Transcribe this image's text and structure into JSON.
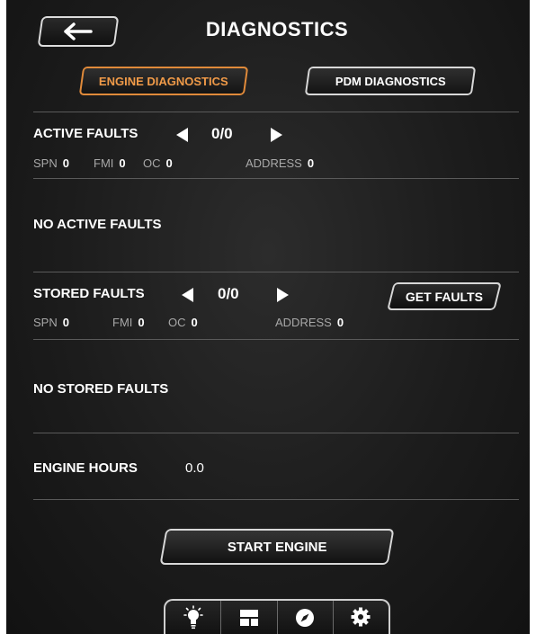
{
  "header": {
    "title": "DIAGNOSTICS",
    "back_icon": "arrow-left-icon"
  },
  "tabs": [
    {
      "label": "ENGINE DIAGNOSTICS",
      "active": true
    },
    {
      "label": "PDM DIAGNOSTICS",
      "active": false
    }
  ],
  "active_faults": {
    "label": "ACTIVE FAULTS",
    "counter": "0/0",
    "spn_label": "SPN",
    "spn": "0",
    "fmi_label": "FMI",
    "fmi": "0",
    "oc_label": "OC",
    "oc": "0",
    "address_label": "ADDRESS",
    "address": "0",
    "message": "NO ACTIVE FAULTS"
  },
  "stored_faults": {
    "label": "STORED FAULTS",
    "counter": "0/0",
    "get_button": "GET FAULTS",
    "spn_label": "SPN",
    "spn": "0",
    "fmi_label": "FMI",
    "fmi": "0",
    "oc_label": "OC",
    "oc": "0",
    "address_label": "ADDRESS",
    "address": "0",
    "message": "NO STORED FAULTS"
  },
  "engine_hours": {
    "label": "ENGINE HOURS",
    "value": "0.0"
  },
  "start_button": "START ENGINE",
  "bottom_nav": [
    {
      "icon": "lightbulb-icon"
    },
    {
      "icon": "panels-icon"
    },
    {
      "icon": "compass-icon"
    },
    {
      "icon": "gear-icon",
      "active": true
    }
  ],
  "colors": {
    "accent": "#f09a48",
    "background": "#1c1c1c",
    "muted_text": "#a8a8a8"
  }
}
